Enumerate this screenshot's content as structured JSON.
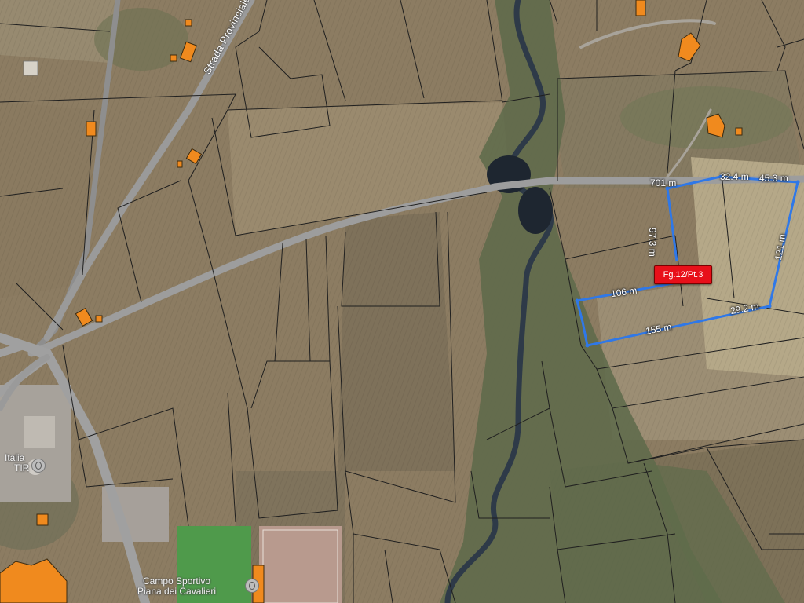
{
  "map": {
    "road_label": "Strada Provinciale III per L",
    "parcel_label": "Fg.12/Pt.3",
    "measurements": [
      {
        "id": "701",
        "text": "701 m"
      },
      {
        "id": "324",
        "text": "32.4 m"
      },
      {
        "id": "453",
        "text": "45.3 m"
      },
      {
        "id": "973",
        "text": "97.3 m"
      },
      {
        "id": "121",
        "text": "121 m"
      },
      {
        "id": "106",
        "text": "106 m"
      },
      {
        "id": "292",
        "text": "29.2 m"
      },
      {
        "id": "155",
        "text": "155 m"
      }
    ],
    "poi": {
      "sport_center": [
        "Campo Sportivo",
        "Piana dei Cavalieri"
      ],
      "italia_tir": [
        "Italia",
        "TIR"
      ]
    },
    "colors": {
      "field": "#8c7c62",
      "field_light": "#a5957a",
      "field_dark": "#6f6450",
      "vegetation": "#5d6a4a",
      "river": "#2e3a48",
      "road": "#9a9a9a",
      "parcel_boundary": "#1f1f1f",
      "measurement_line": "#2f78e8",
      "building": "#f08a1e",
      "label_badge": "#e8101a"
    }
  }
}
